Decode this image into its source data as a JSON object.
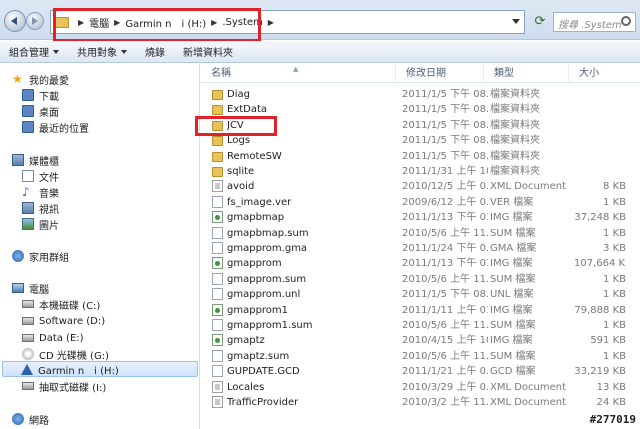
{
  "address": {
    "crumbs": [
      "電腦",
      "Garmin n　i (H:)",
      ".System"
    ]
  },
  "search": {
    "placeholder": "搜尋 .System"
  },
  "toolbar": {
    "organize": "組合管理",
    "share": "共用對象",
    "burn": "燒錄",
    "new_folder": "新增資料夾"
  },
  "nav": {
    "favorites": "我的最愛",
    "downloads": "下載",
    "desktop": "桌面",
    "recent": "最近的位置",
    "libraries": "媒體櫃",
    "documents": "文件",
    "music": "音樂",
    "videos": "視訊",
    "pictures": "圖片",
    "homegroup": "家用群組",
    "computer": "電腦",
    "drive_c": "本機磁碟 (C:)",
    "drive_d": "Software (D:)",
    "drive_e": "Data (E:)",
    "drive_g": "CD 光碟機 (G:)",
    "drive_h": "Garmin n　i (H:)",
    "drive_i": "抽取式磁碟 (I:)",
    "network": "網路"
  },
  "columns": {
    "name": "名稱",
    "date": "修改日期",
    "type": "類型",
    "size": "大小"
  },
  "files": [
    {
      "name": "Diag",
      "date": "2011/1/5 下午 08...",
      "type": "檔案資料夾",
      "size": "",
      "icon": "folder"
    },
    {
      "name": "ExtData",
      "date": "2011/1/5 下午 08...",
      "type": "檔案資料夾",
      "size": "",
      "icon": "folder"
    },
    {
      "name": "JCV",
      "date": "2011/1/5 下午 08...",
      "type": "檔案資料夾",
      "size": "",
      "icon": "folder"
    },
    {
      "name": "Logs",
      "date": "2011/1/5 下午 08...",
      "type": "檔案資料夾",
      "size": "",
      "icon": "folder"
    },
    {
      "name": "RemoteSW",
      "date": "2011/1/5 下午 08...",
      "type": "檔案資料夾",
      "size": "",
      "icon": "folder"
    },
    {
      "name": "sqlite",
      "date": "2011/1/31 上午 10...",
      "type": "檔案資料夾",
      "size": "",
      "icon": "folder"
    },
    {
      "name": "avoid",
      "date": "2010/12/5 上午 0...",
      "type": "XML Document",
      "size": "8 KB",
      "icon": "xml"
    },
    {
      "name": "fs_image.ver",
      "date": "2009/6/12 上午 0...",
      "type": "VER 檔案",
      "size": "1 KB",
      "icon": "file"
    },
    {
      "name": "gmapbmap",
      "date": "2011/1/13 下午 01...",
      "type": "IMG 檔案",
      "size": "37,248 KB",
      "icon": "img"
    },
    {
      "name": "gmapbmap.sum",
      "date": "2010/5/6 上午 11...",
      "type": "SUM 檔案",
      "size": "1 KB",
      "icon": "file"
    },
    {
      "name": "gmapprom.gma",
      "date": "2011/1/24 下午 0...",
      "type": "GMA 檔案",
      "size": "3 KB",
      "icon": "file"
    },
    {
      "name": "gmapprom",
      "date": "2011/1/13 下午 01...",
      "type": "IMG 檔案",
      "size": "107,664 KB",
      "icon": "img"
    },
    {
      "name": "gmapprom.sum",
      "date": "2010/5/6 上午 11...",
      "type": "SUM 檔案",
      "size": "1 KB",
      "icon": "file"
    },
    {
      "name": "gmapprom.unl",
      "date": "2011/1/5 下午 08...",
      "type": "UNL 檔案",
      "size": "1 KB",
      "icon": "file"
    },
    {
      "name": "gmapprom1",
      "date": "2011/1/11 上午 01...",
      "type": "IMG 檔案",
      "size": "79,888 KB",
      "icon": "img"
    },
    {
      "name": "gmapprom1.sum",
      "date": "2010/5/6 上午 11...",
      "type": "SUM 檔案",
      "size": "1 KB",
      "icon": "file"
    },
    {
      "name": "gmaptz",
      "date": "2010/4/15 上午 10...",
      "type": "IMG 檔案",
      "size": "591 KB",
      "icon": "img"
    },
    {
      "name": "gmaptz.sum",
      "date": "2010/5/6 上午 11...",
      "type": "SUM 檔案",
      "size": "1 KB",
      "icon": "file"
    },
    {
      "name": "GUPDATE.GCD",
      "date": "2011/1/21 上午 0...",
      "type": "GCD 檔案",
      "size": "33,219 KB",
      "icon": "file"
    },
    {
      "name": "Locales",
      "date": "2010/3/29 上午 0...",
      "type": "XML Document",
      "size": "13 KB",
      "icon": "xml"
    },
    {
      "name": "TrafficProvider",
      "date": "2010/3/2 上午 11...",
      "type": "XML Document",
      "size": "24 KB",
      "icon": "xml"
    }
  ],
  "watermark": "#277019",
  "colors": {
    "highlight_box": "#e0222a",
    "folder": "#e9c25a"
  }
}
